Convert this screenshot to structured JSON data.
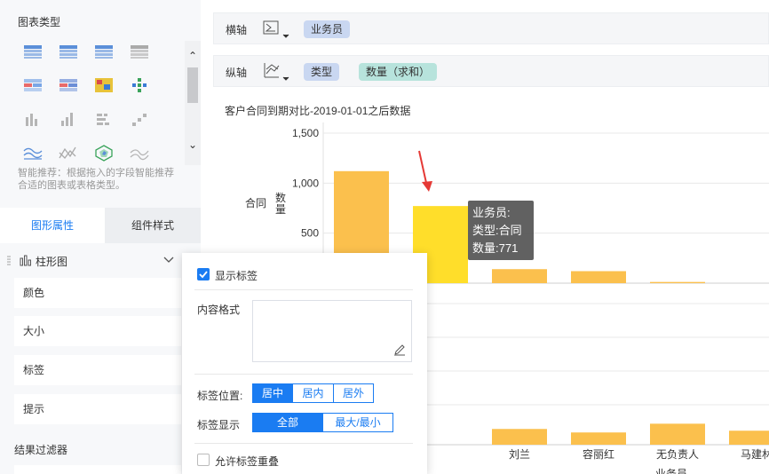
{
  "left_panel": {
    "chart_type_title": "图表类型",
    "icons": [
      "table-icon",
      "cross-table-icon",
      "grouped-table-icon",
      "kpi-number-icon",
      "color-table-icon",
      "colored-cross-table-icon",
      "heatmap-icon",
      "scatter-grid-icon",
      "bar-chart-icon",
      "column-chart-icon",
      "stacked-bar-icon",
      "step-chart-icon",
      "line-chart-icon",
      "area-chart-icon",
      "radar-chart-icon",
      "stream-chart-icon"
    ],
    "smart_tip": "智能推荐：根据拖入的字段智能推荐合适的图表或表格类型。",
    "tabs": {
      "shape_props": "图形属性",
      "component_style": "组件样式"
    },
    "chart_select": "柱形图",
    "props": {
      "color": "颜色",
      "size": "大小",
      "label": "标签",
      "tooltip": "提示"
    },
    "filter_title": "结果过滤器"
  },
  "axes": {
    "x": {
      "label": "横轴",
      "fields": [
        "业务员"
      ]
    },
    "y": {
      "label": "纵轴",
      "fields": [
        "类型",
        "数量（求和）"
      ]
    }
  },
  "chart": {
    "title": "客户合同到期对比-2019-01-01之后数据",
    "colors": {
      "bar": "#fbc04d",
      "highlight": "#ffde2a",
      "grid": "#e8e8e8"
    }
  },
  "chart_data": {
    "type": "bar",
    "title": "客户合同到期对比-2019-01-01之后数据",
    "xlabel": "业务员",
    "ylabel": "数量",
    "ylim": [
      0,
      1500
    ],
    "yticks": [
      "1,500",
      "1,000",
      "500"
    ],
    "categories": [
      "",
      "",
      "刘兰",
      "容丽红",
      "无负责人",
      "马建林"
    ],
    "series": [
      {
        "name": "合同",
        "values": [
          1120,
          771,
          140,
          120,
          12,
          0
        ]
      },
      {
        "values": [
          0,
          0,
          45,
          35,
          60,
          40
        ]
      }
    ]
  },
  "tooltip": {
    "line1": "业务员:",
    "line2": "类型:合同",
    "line3": "数量:771"
  },
  "label_popup": {
    "show_label": "显示标签",
    "content_format": "内容格式",
    "position_label": "标签位置:",
    "position_options": [
      "居中",
      "居内",
      "居外"
    ],
    "display_label": "标签显示",
    "display_options": [
      "全部",
      "最大/最小"
    ],
    "allow_overlap": "允许标签重叠"
  }
}
